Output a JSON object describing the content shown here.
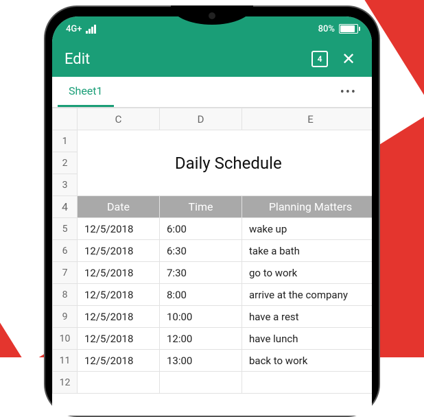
{
  "statusbar": {
    "network": "4G+",
    "battery_pct": "80%"
  },
  "header": {
    "title": "Edit",
    "tab_count": "4"
  },
  "sheetbar": {
    "active_tab": "Sheet1"
  },
  "sheet": {
    "columns": [
      "C",
      "D",
      "E"
    ],
    "row_labels": [
      "1",
      "2",
      "3",
      "4",
      "5",
      "6",
      "7",
      "8",
      "9",
      "10",
      "11",
      "12"
    ],
    "title": "Daily Schedule",
    "header_row": {
      "date": "Date",
      "time": "Time",
      "matters": "Planning Matters"
    },
    "rows": [
      {
        "date": "12/5/2018",
        "time": "6:00",
        "matters": "wake up"
      },
      {
        "date": "12/5/2018",
        "time": "6:30",
        "matters": "take a bath"
      },
      {
        "date": "12/5/2018",
        "time": "7:30",
        "matters": "go to work"
      },
      {
        "date": "12/5/2018",
        "time": "8:00",
        "matters": "arrive at the company"
      },
      {
        "date": "12/5/2018",
        "time": "10:00",
        "matters": "have a rest"
      },
      {
        "date": "12/5/2018",
        "time": "12:00",
        "matters": "have lunch"
      },
      {
        "date": "12/5/2018",
        "time": "13:00",
        "matters": "back to work"
      }
    ]
  }
}
